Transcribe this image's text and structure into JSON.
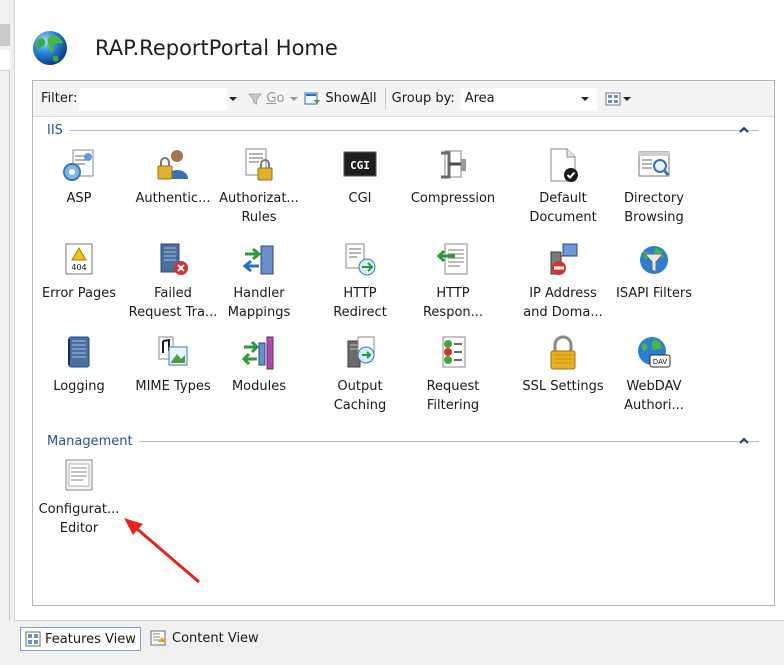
{
  "header": {
    "title": "RAP.ReportPortal Home"
  },
  "toolbar": {
    "filter_label": "Filter:",
    "filter_value": "",
    "go_label_rest": "o",
    "go_label_u": "G",
    "showall_u": "A",
    "showall_pre": "Show ",
    "showall_post": "ll",
    "groupby_label": "Group by:",
    "groupby_value": "Area"
  },
  "groups": {
    "iis": {
      "name": "IIS"
    },
    "management": {
      "name": "Management"
    }
  },
  "features": {
    "asp": "ASP",
    "authentication": "Authentic...",
    "authorization": "Authorizat...\nRules",
    "cgi": "CGI",
    "compression": "Compression",
    "default_document": "Default\nDocument",
    "directory_browsing": "Directory\nBrowsing",
    "error_pages": "Error Pages",
    "failed_request": "Failed\nRequest Tra...",
    "handler_mappings": "Handler\nMappings",
    "http_redirect": "HTTP\nRedirect",
    "http_response": "HTTP\nRespon...",
    "ip_address": "IP Address\nand Doma...",
    "isapi_filters": "ISAPI Filters",
    "logging": "Logging",
    "mime_types": "MIME Types",
    "modules": "Modules",
    "output_caching": "Output\nCaching",
    "request_filtering": "Request\nFiltering",
    "ssl_settings": "SSL Settings",
    "webdav": "WebDAV\nAuthori...",
    "configuration_editor": "Configurat...\nEditor"
  },
  "icon_texts": {
    "cgi": "CGI",
    "error_code": "404",
    "dav": "DAV"
  },
  "bottom": {
    "features_view": "Features View",
    "content_view": "Content View"
  },
  "colors": {
    "group_header": "#2b4fa8",
    "annotation_arrow": "#e8231f"
  }
}
